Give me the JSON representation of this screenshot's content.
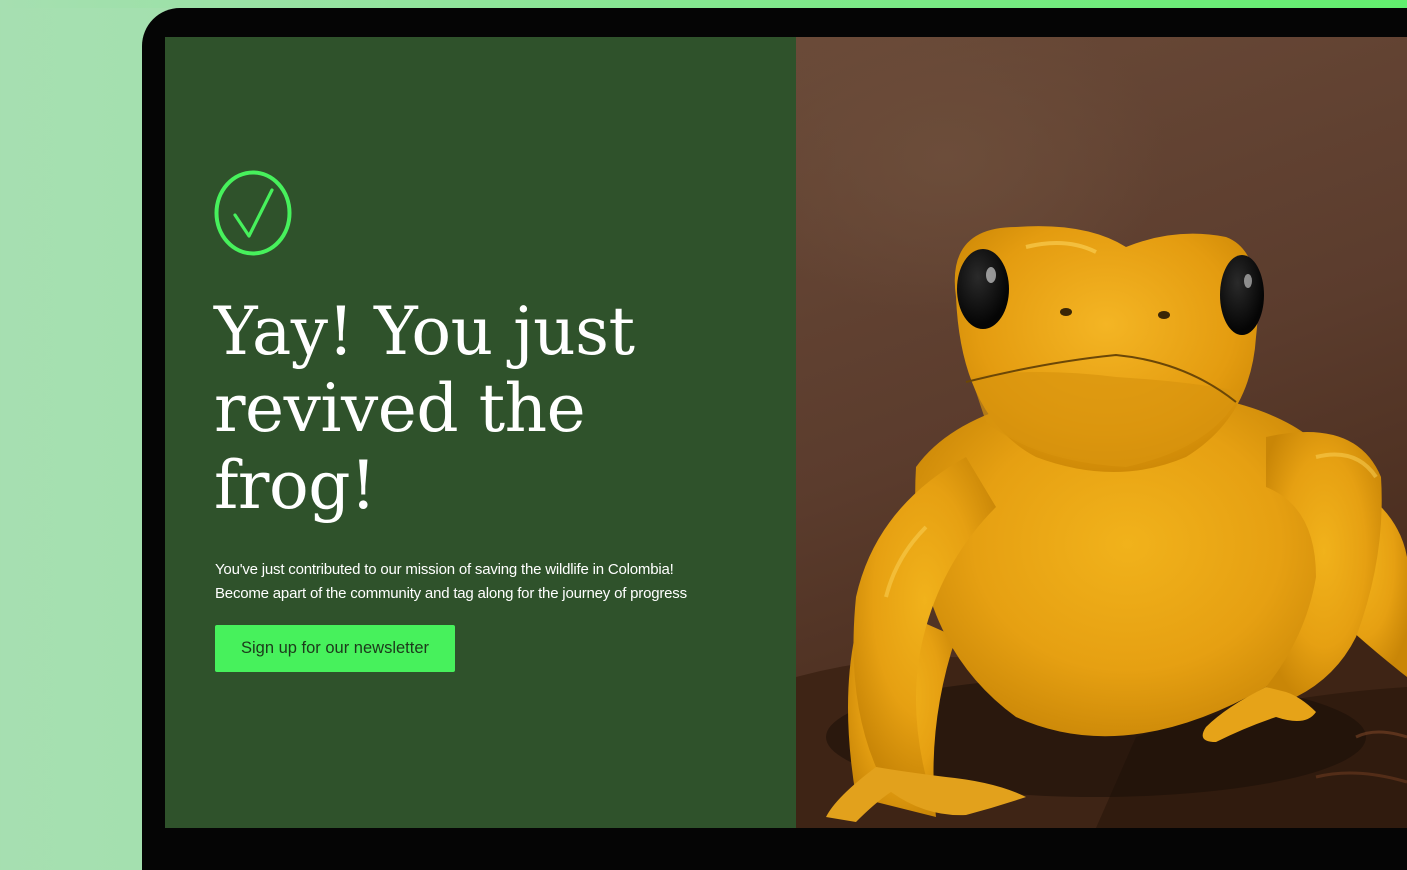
{
  "hero": {
    "headline": "Yay! You just revived the frog!",
    "description_line1": "You've just contributed to our mission of saving the wildlife in Colombia!",
    "description_line2": "Become apart of the community and tag along for the journey of progress",
    "cta_label": "Sign up for our newsletter"
  },
  "icons": {
    "success": "check-circle-icon"
  },
  "image": {
    "subject": "golden-poison-frog-photo"
  },
  "colors": {
    "panel": "#2f522b",
    "accent": "#47f15c",
    "background": "#a6dfb1",
    "frame": "#050505"
  }
}
